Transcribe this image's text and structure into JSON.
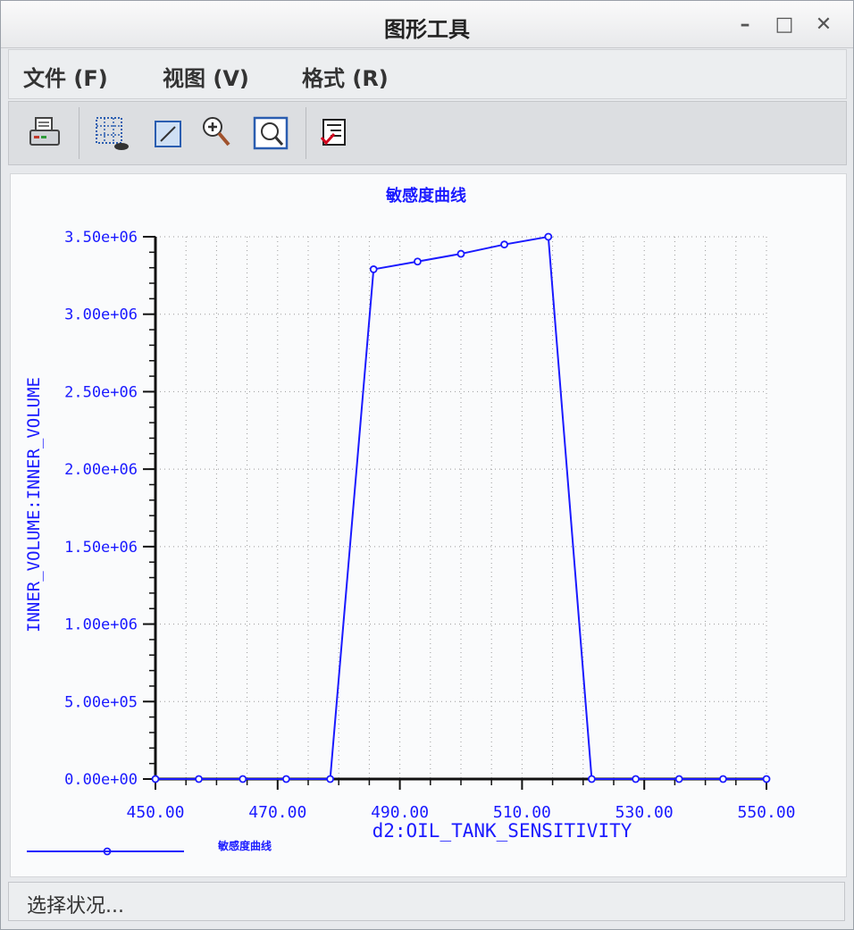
{
  "window": {
    "title": "图形工具"
  },
  "window_controls": {
    "minimize": "–",
    "maximize": "□",
    "close": "✕"
  },
  "menubar": {
    "items": [
      "文件 (F)",
      "视图 (V)",
      "格式 (R)"
    ]
  },
  "toolbar": {
    "buttons": [
      "print-icon",
      "grid-icon",
      "edit-icon",
      "zoom-in-icon",
      "zoom-fit-icon",
      "format-icon"
    ]
  },
  "statusbar": {
    "text": "选择状况..."
  },
  "colors": {
    "series": "#1a1aff",
    "axis": "#111111",
    "grid": "#9a9a9a"
  },
  "chart_data": {
    "type": "line",
    "title": "敏感度曲线",
    "xlabel": "d2:OIL_TANK_SENSITIVITY",
    "ylabel": "INNER_VOLUME:INNER_VOLUME",
    "xlim": [
      450,
      550
    ],
    "ylim": [
      0,
      3500000
    ],
    "x_ticks": [
      "450.00",
      "470.00",
      "490.00",
      "510.00",
      "530.00",
      "550.00"
    ],
    "y_ticks": [
      "0.00e+00",
      "5.00e+05",
      "1.00e+06",
      "1.50e+06",
      "2.00e+06",
      "2.50e+06",
      "3.00e+06",
      "3.50e+06"
    ],
    "grid": true,
    "legend_position": "bottom-left",
    "series": [
      {
        "name": "敏感度曲线",
        "x": [
          450,
          457.1,
          464.3,
          471.4,
          478.6,
          485.7,
          492.9,
          500,
          507.1,
          514.3,
          521.4,
          528.6,
          535.7,
          542.9,
          550
        ],
        "y": [
          0,
          0,
          0,
          0,
          0,
          3290000,
          3340000,
          3390000,
          3450000,
          3500000,
          0,
          0,
          0,
          0,
          0
        ]
      }
    ]
  }
}
